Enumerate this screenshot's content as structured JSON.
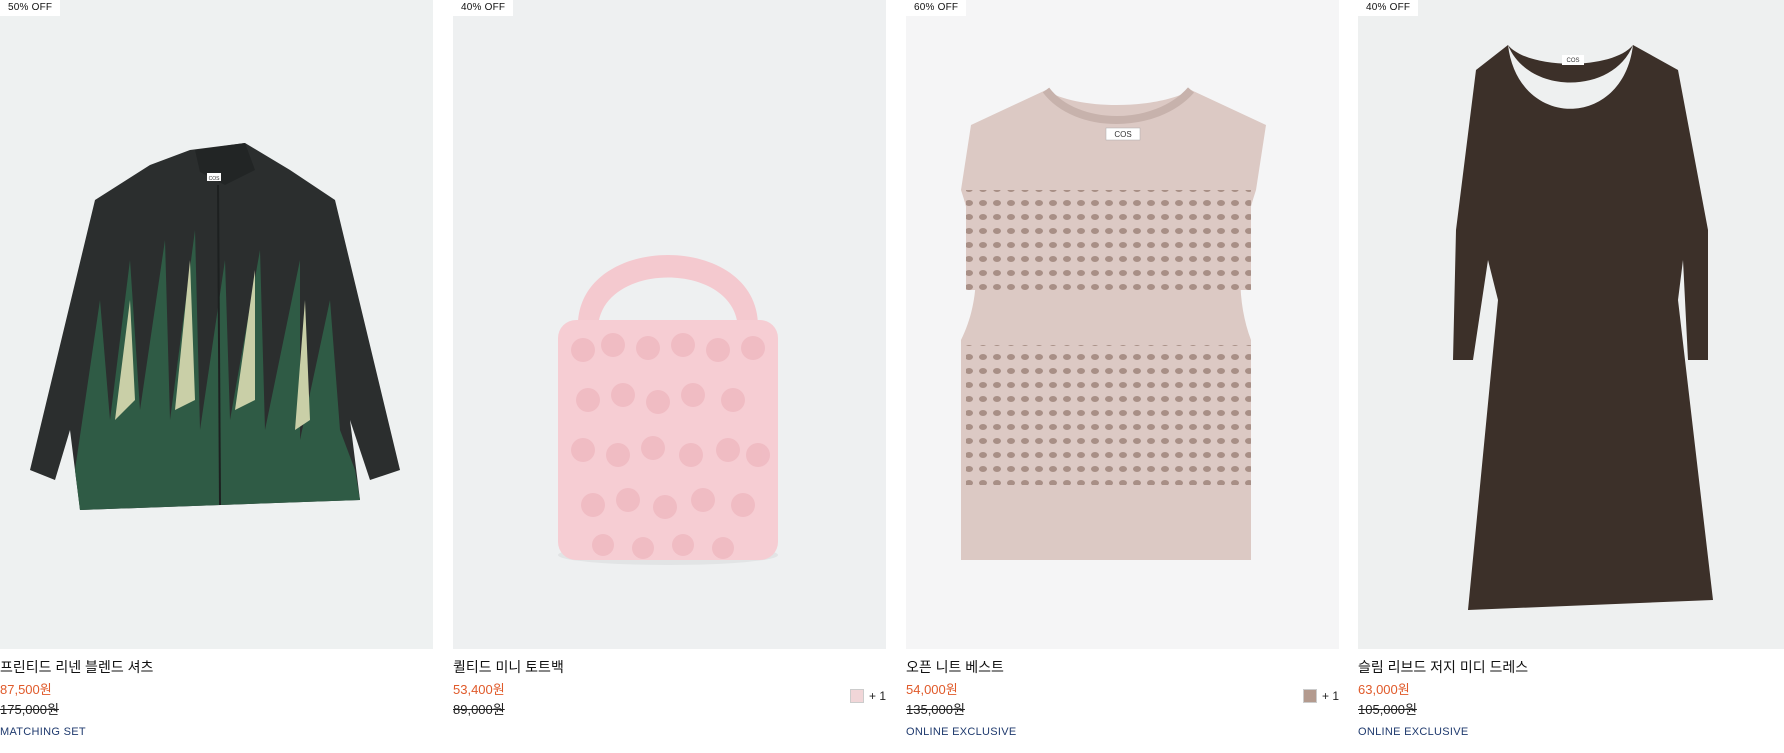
{
  "products": [
    {
      "badge": "50% OFF",
      "title": "프린티드 리넨 블렌드 셔츠",
      "price": "87,500원",
      "original_price": "175,000원",
      "tag": "MATCHING SET",
      "swatch_count": "",
      "swatch_color": "",
      "bg": "#eef1f1"
    },
    {
      "badge": "40% OFF",
      "title": "퀼티드 미니 토트백",
      "price": "53,400원",
      "original_price": "89,000원",
      "tag": "",
      "swatch_count": "+ 1",
      "swatch_color": "#f1d6d8",
      "bg": "#eef0f1"
    },
    {
      "badge": "60% OFF",
      "title": "오픈 니트 베스트",
      "price": "54,000원",
      "original_price": "135,000원",
      "tag": "ONLINE EXCLUSIVE",
      "swatch_count": "+ 1",
      "swatch_color": "#b39a8e",
      "bg": "#f5f5f6"
    },
    {
      "badge": "40% OFF",
      "title": "슬림 리브드 저지 미디 드레스",
      "price": "63,000원",
      "original_price": "105,000원",
      "tag": "ONLINE EXCLUSIVE",
      "swatch_count": "",
      "swatch_color": "",
      "bg": "#eef0f0"
    }
  ],
  "brand_label": "COS"
}
